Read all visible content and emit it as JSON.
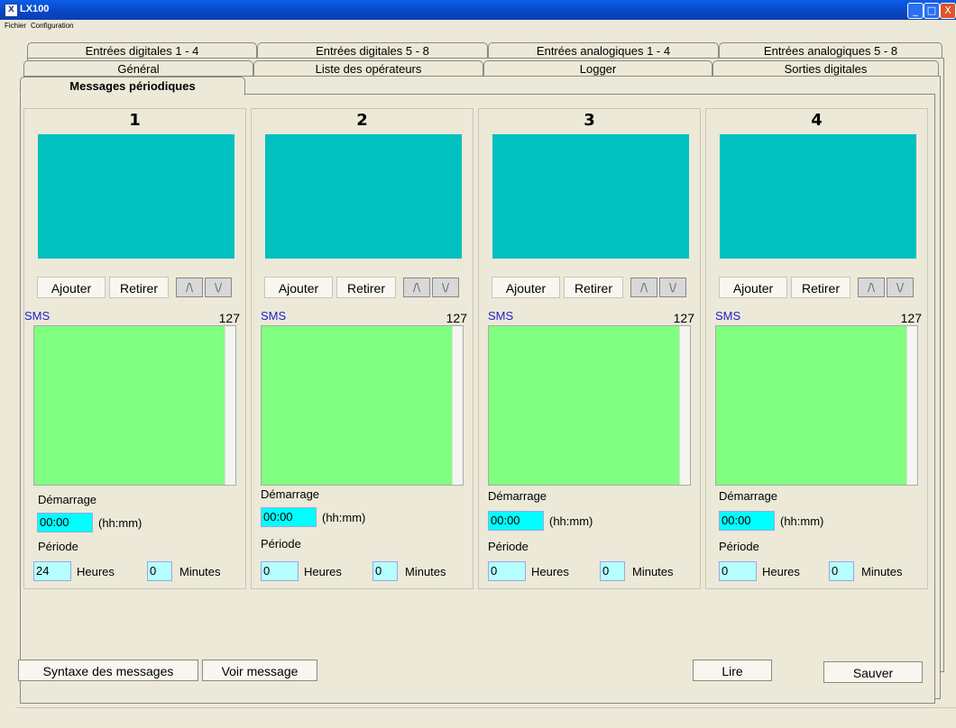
{
  "window": {
    "title": "LX100",
    "icon": "lx-app-icon",
    "minimize": "_",
    "maximize": "□",
    "close": "X"
  },
  "menu": [
    "Fichier",
    "Configuration"
  ],
  "tabs": {
    "row1": [
      "Entrées digitales 1 - 4",
      "Entrées digitales 5 - 8",
      "Entrées analogiques 1 - 4",
      "Entrées analogiques 5 - 8"
    ],
    "row2": [
      "Général",
      "Liste des opérateurs",
      "Logger",
      "Sorties digitales"
    ],
    "active": "Messages périodiques"
  },
  "columns": [
    {
      "num": "1",
      "add": "Ajouter",
      "remove": "Retirer",
      "up": "/\\",
      "down": "\\/",
      "sms": "SMS",
      "count": "127",
      "start_label": "Démarrage",
      "start_value": "00:00",
      "start_unit": "(hh:mm)",
      "period_label": "Période",
      "hours_value": "24",
      "hours_label": "Heures",
      "minutes_value": "0",
      "minutes_label": "Minutes"
    },
    {
      "num": "2",
      "add": "Ajouter",
      "remove": "Retirer",
      "up": "/\\",
      "down": "\\/",
      "sms": "SMS",
      "count": "127",
      "start_label": "Démarrage",
      "start_value": "00:00",
      "start_unit": "(hh:mm)",
      "period_label": "Période",
      "hours_value": "0",
      "hours_label": "Heures",
      "minutes_value": "0",
      "minutes_label": "Minutes"
    },
    {
      "num": "3",
      "add": "Ajouter",
      "remove": "Retirer",
      "up": "/\\",
      "down": "\\/",
      "sms": "SMS",
      "count": "127",
      "start_label": "Démarrage",
      "start_value": "00:00",
      "start_unit": "(hh:mm)",
      "period_label": "Période",
      "hours_value": "0",
      "hours_label": "Heures",
      "minutes_value": "0",
      "minutes_label": "Minutes"
    },
    {
      "num": "4",
      "add": "Ajouter",
      "remove": "Retirer",
      "up": "/\\",
      "down": "\\/",
      "sms": "SMS",
      "count": "127",
      "start_label": "Démarrage",
      "start_value": "00:00",
      "start_unit": "(hh:mm)",
      "period_label": "Période",
      "hours_value": "0",
      "hours_label": "Heures",
      "minutes_value": "0",
      "minutes_label": "Minutes"
    }
  ],
  "bottom": {
    "syntax": "Syntaxe des messages",
    "view": "Voir message",
    "read": "Lire",
    "save": "Sauver"
  },
  "colors": {
    "teal": "#00c0c0",
    "green": "#80ff80",
    "time": "#00ffff",
    "field": "#b6ffff"
  }
}
